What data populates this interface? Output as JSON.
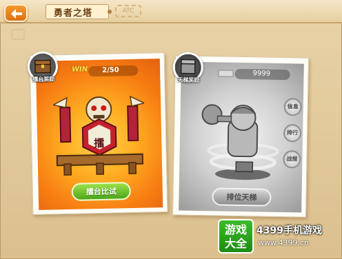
{
  "header": {
    "title": "勇者之塔",
    "title_deco": "ATC"
  },
  "left_card": {
    "badge_label": "擂台奖励",
    "win_label": "WIN",
    "score": "2/50",
    "emblem_char": "擂",
    "button_label": "擂台比试"
  },
  "right_card": {
    "badge_label": "天梯奖励",
    "gold": "9999",
    "button_label": "排位天梯",
    "side_items": [
      {
        "label": "信息",
        "icon": "info-icon"
      },
      {
        "label": "排行",
        "icon": "rank-icon"
      },
      {
        "label": "战报",
        "icon": "report-icon"
      }
    ]
  },
  "watermark": {
    "box_text_line1": "游戏",
    "box_text_line2": "大全",
    "title": "4399手机游戏",
    "url": "www.4399.cn"
  },
  "colors": {
    "accent_orange": "#f59a2e",
    "button_green": "#4ca51a",
    "card_orange": "#f77d12"
  }
}
